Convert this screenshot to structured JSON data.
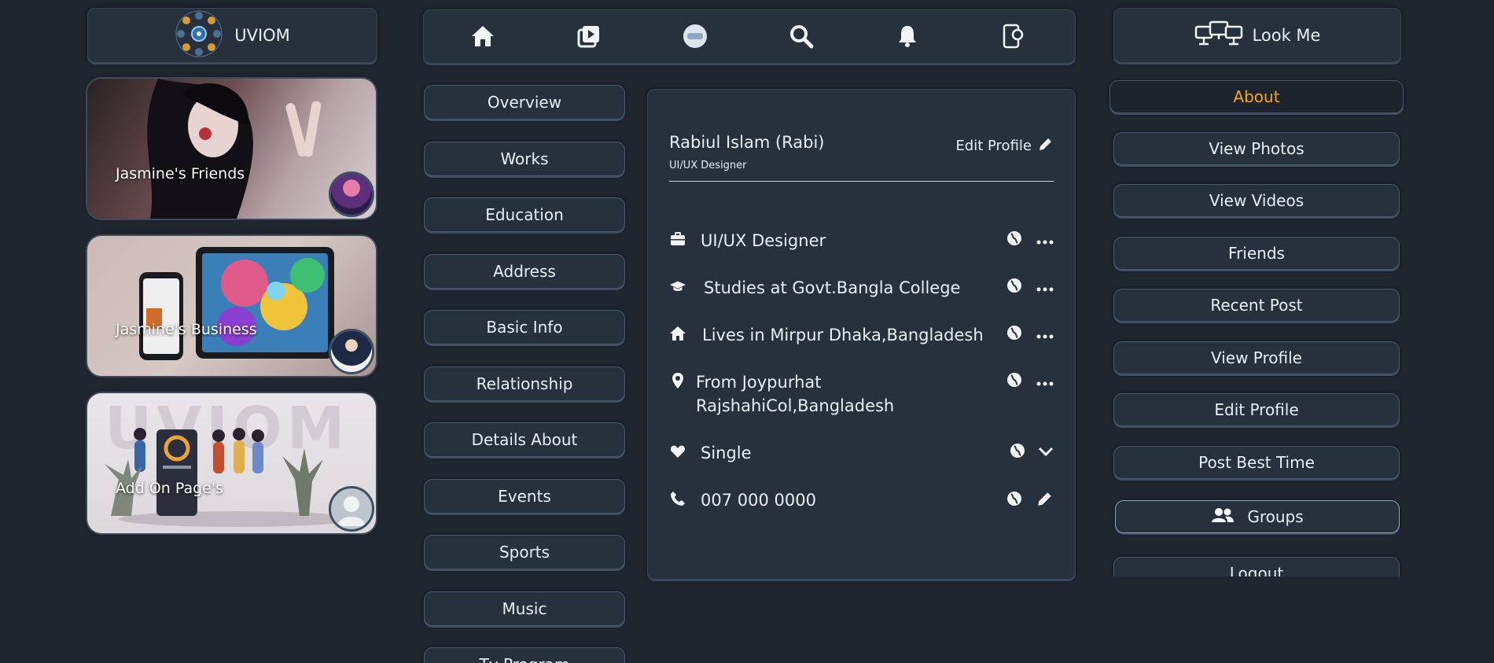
{
  "brand": {
    "name": "UVIOM",
    "icon": "uviom-logo"
  },
  "cards": [
    {
      "label": "Jasmine's Friends",
      "icon": "anime-avatar"
    },
    {
      "label": "Jasmine's Business",
      "icon": "business-avatar"
    },
    {
      "label": "Add On Page's",
      "icon": "default-avatar",
      "banner_text": "UVIOM"
    }
  ],
  "topnav": [
    {
      "icon": "home-icon"
    },
    {
      "icon": "video-library-icon"
    },
    {
      "icon": "uviom-badge-icon"
    },
    {
      "icon": "search-icon"
    },
    {
      "icon": "bell-icon"
    },
    {
      "icon": "phone-settings-icon"
    }
  ],
  "menu": [
    "Overview",
    "Works",
    "Education",
    "Address",
    "Basic Info",
    "Relationship",
    "Details About",
    "Events",
    "Sports",
    "Music",
    "Tv Program"
  ],
  "profile": {
    "name": "Rabiul Islam (Rabi)",
    "role": "UI/UX Designer",
    "edit_label": "Edit Profile",
    "rows": [
      {
        "icon": "briefcase-icon",
        "text": "UI/UX Designer",
        "action": "more"
      },
      {
        "icon": "graduation-cap-icon",
        "text": "Studies at Govt.Bangla College",
        "action": "more"
      },
      {
        "icon": "home-icon",
        "text": "Lives in Mirpur Dhaka,Bangladesh",
        "action": "more"
      },
      {
        "icon": "location-pin-icon",
        "text": "From Joypurhat RajshahiCol,Bangladesh",
        "action": "more"
      },
      {
        "icon": "heart-icon",
        "text": "Single",
        "action": "chevron"
      },
      {
        "icon": "phone-icon",
        "text": "007 000 0000",
        "action": "edit"
      }
    ]
  },
  "right": {
    "look_me": "Look Me",
    "about": "About",
    "items": [
      "View Photos",
      "View Videos",
      "Friends",
      "Recent Post",
      "View Profile",
      "Edit Profile",
      "Post Best Time",
      "Groups",
      "Logout"
    ]
  },
  "colors": {
    "bg": "#1f2630",
    "panel": "#27313e",
    "accent": "#f5a524"
  }
}
